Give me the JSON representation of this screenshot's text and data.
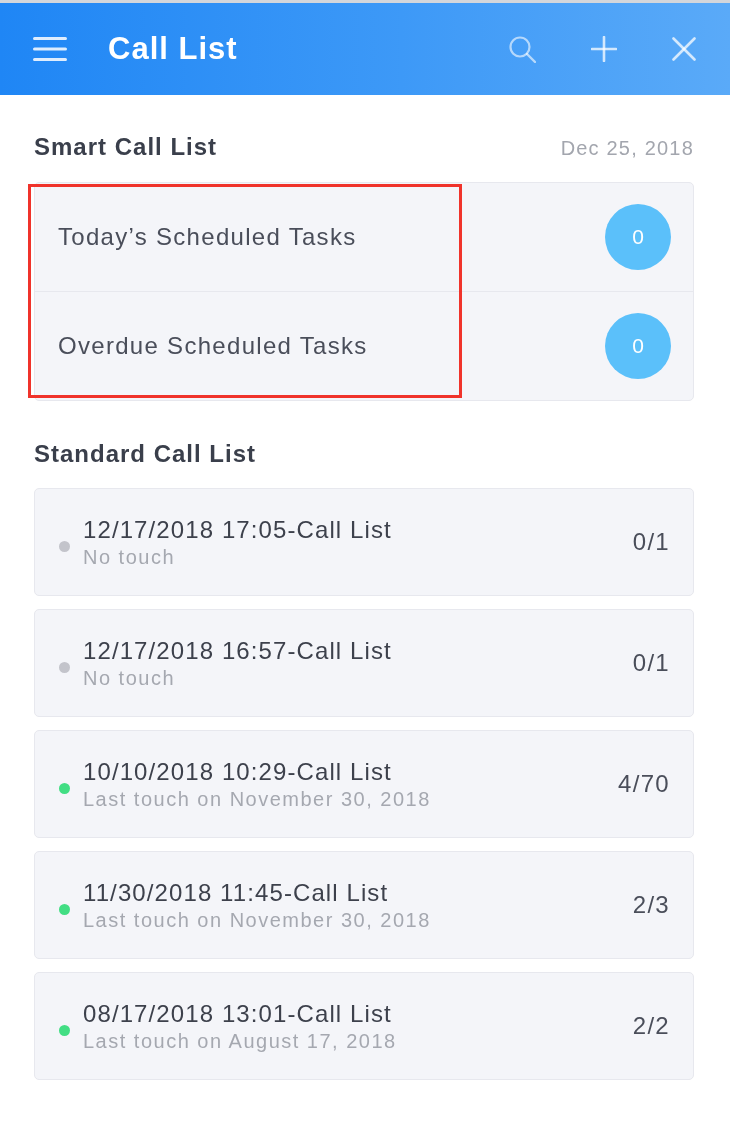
{
  "app_bar": {
    "title": "Call List"
  },
  "smart_list": {
    "heading": "Smart Call List",
    "date": "Dec 25, 2018",
    "highlighted": true,
    "items": [
      {
        "label": "Today’s Scheduled Tasks",
        "count": "0"
      },
      {
        "label": "Overdue Scheduled Tasks",
        "count": "0"
      }
    ]
  },
  "standard_list": {
    "heading": "Standard Call List",
    "items": [
      {
        "title": "12/17/2018 17:05-Call List",
        "subtitle": "No touch",
        "progress": "0/1",
        "color": "#c3c4cb"
      },
      {
        "title": "12/17/2018 16:57-Call List",
        "subtitle": "No touch",
        "progress": "0/1",
        "color": "#c3c4cb"
      },
      {
        "title": "10/10/2018 10:29-Call List",
        "subtitle": "Last touch on November 30, 2018",
        "progress": "4/70",
        "color": "#42de84"
      },
      {
        "title": "11/30/2018 11:45-Call List",
        "subtitle": "Last touch on November 30, 2018",
        "progress": "2/3",
        "color": "#42de84"
      },
      {
        "title": "08/17/2018 13:01-Call List",
        "subtitle": "Last touch on August 17, 2018",
        "progress": "2/2",
        "color": "#42de84"
      }
    ]
  }
}
